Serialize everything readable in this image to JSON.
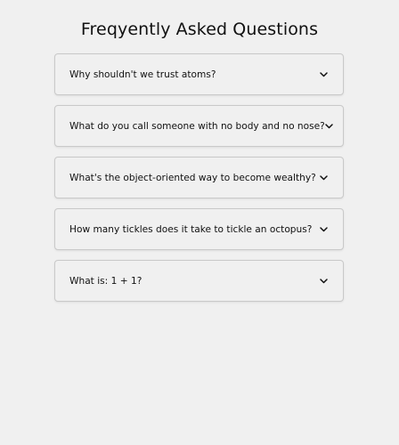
{
  "page": {
    "title": "Freqyently Asked Questions"
  },
  "faq": {
    "items": [
      {
        "question": "Why shouldn't we trust atoms?",
        "icon": "chevron-down-icon"
      },
      {
        "question": "What do you call someone with no body and no nose?",
        "icon": "chevron-down-icon"
      },
      {
        "question": "What's the object-oriented way to become wealthy?",
        "icon": "chevron-down-icon"
      },
      {
        "question": "How many tickles does it take to tickle an octopus?",
        "icon": "chevron-down-icon"
      },
      {
        "question": "What is: 1 + 1?",
        "icon": "chevron-down-icon"
      }
    ]
  },
  "colors": {
    "background": "#f0f0f0",
    "border": "#c9c9c9",
    "text": "#111111"
  }
}
